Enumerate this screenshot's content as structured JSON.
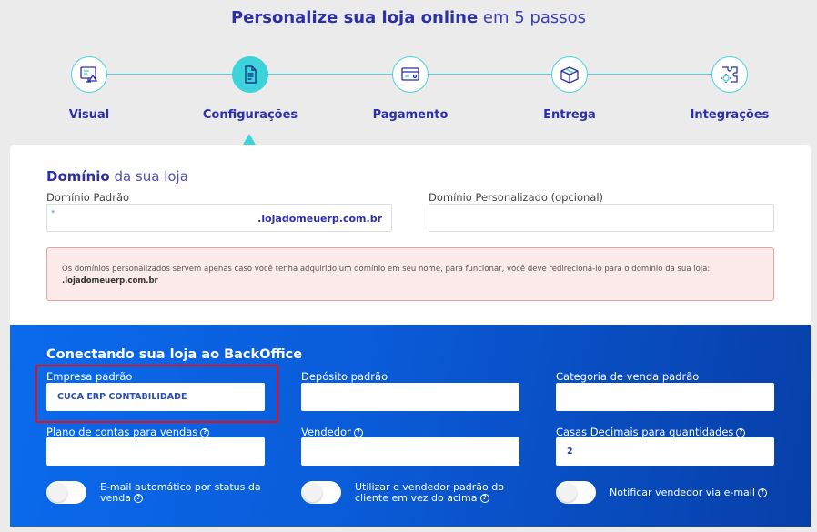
{
  "header": {
    "title_bold": "Personalize sua loja online",
    "title_light": "em 5 passos"
  },
  "steps": [
    {
      "label": "Visual",
      "icon": "monitor-icon",
      "active": false
    },
    {
      "label": "Configurações",
      "icon": "document-icon",
      "active": true
    },
    {
      "label": "Pagamento",
      "icon": "payment-card-icon",
      "active": false
    },
    {
      "label": "Entrega",
      "icon": "box-icon",
      "active": false
    },
    {
      "label": "Integrações",
      "icon": "puzzle-gear-icon",
      "active": false
    }
  ],
  "domain": {
    "title_bold": "Domínio",
    "title_light": "da sua loja",
    "default_label": "Domínio Padrão",
    "default_prefix": "*",
    "default_suffix": ".lojadomeuerp.com.br",
    "custom_label": "Domínio Personalizado (opcional)",
    "custom_value": "",
    "alert_text": "Os domínios personalizados servem apenas caso você tenha adquirido um domínio em seu nome, para funcionar, você deve redirecioná-lo para o domínio da sua loja:",
    "alert_domain": ".lojadomeuerp.com.br"
  },
  "backoffice": {
    "title": "Conectando sua loja ao BackOffice",
    "empresa_label": "Empresa padrão",
    "empresa_value": "CUCA ERP CONTABILIDADE",
    "deposito_label": "Depósito padrão",
    "deposito_value": "",
    "categoria_label": "Categoria de venda padrão",
    "categoria_value": "",
    "plano_label": "Plano de contas para vendas",
    "plano_value": "",
    "vendedor_label": "Vendedor",
    "vendedor_value": "",
    "casas_label": "Casas Decimais para quantidades",
    "casas_value": "2",
    "toggle1_line1": "E-mail automático por status da",
    "toggle1_line2": "venda",
    "toggle2_line1": "Utilizar o vendedor padrão do",
    "toggle2_line2": "cliente em vez do acima",
    "toggle3_label": "Notificar vendedor via e-mail"
  },
  "colors": {
    "accent": "#2b2fa8",
    "teal": "#3dd3dc",
    "blue_panel": "#0a5bd8",
    "alert_bg": "#fdeaea",
    "highlight": "#e0111d"
  }
}
